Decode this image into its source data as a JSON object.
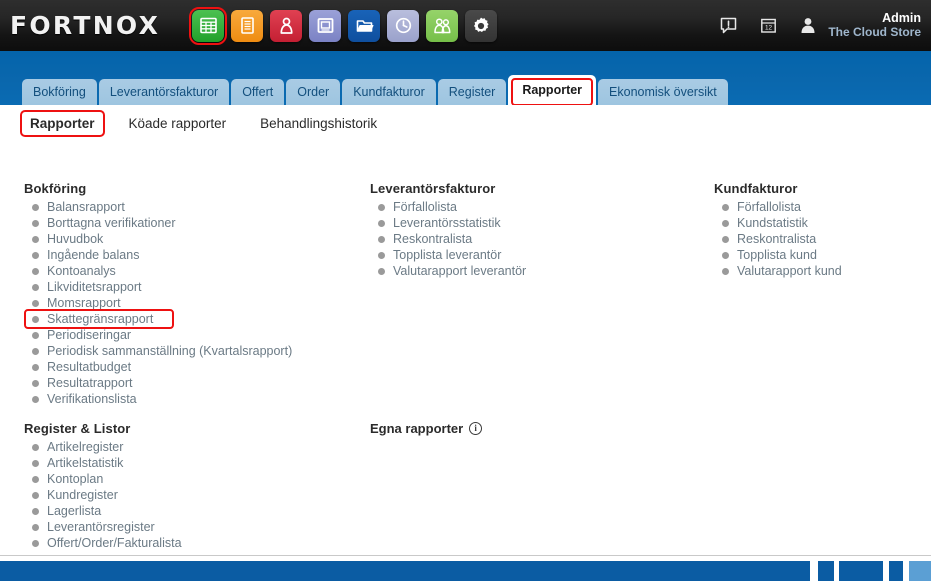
{
  "header": {
    "brand": "FORTNOX",
    "app_icons": [
      {
        "name": "spreadsheet-icon",
        "color": "#2ea732",
        "selected": true
      },
      {
        "name": "document-icon",
        "color": "#ef8c12",
        "selected": false
      },
      {
        "name": "person-icon",
        "color": "#c41f33",
        "selected": false
      },
      {
        "name": "window-icon",
        "color": "#7b82c4",
        "selected": false
      },
      {
        "name": "folder-icon",
        "color": "#0f4f9e",
        "selected": false
      },
      {
        "name": "clock-icon",
        "color": "#9aa1cb",
        "selected": false
      },
      {
        "name": "people-icon",
        "color": "#76bf49",
        "selected": false
      },
      {
        "name": "gear-icon",
        "color": "#333333",
        "selected": false
      }
    ],
    "notification_icon": "alert-icon",
    "calendar_icon": "calendar-icon",
    "calendar_day": "12",
    "avatar_icon": "user-avatar-icon",
    "user_name": "Admin",
    "user_org": "The Cloud Store",
    "accent_highlight": "#ee1111",
    "nav_band_color": "#0a67ad"
  },
  "tabs": [
    {
      "label": "Bokföring",
      "active": false
    },
    {
      "label": "Leverantörsfakturor",
      "active": false
    },
    {
      "label": "Offert",
      "active": false
    },
    {
      "label": "Order",
      "active": false
    },
    {
      "label": "Kundfakturor",
      "active": false
    },
    {
      "label": "Register",
      "active": false
    },
    {
      "label": "Rapporter",
      "active": true
    },
    {
      "label": "Ekonomisk översikt",
      "active": false
    }
  ],
  "subnav": [
    {
      "label": "Rapporter",
      "active": true
    },
    {
      "label": "Köade rapporter",
      "active": false
    },
    {
      "label": "Behandlingshistorik",
      "active": false
    }
  ],
  "groups": {
    "bokforing": {
      "title": "Bokföring",
      "items": [
        {
          "label": "Balansrapport",
          "highlighted": false
        },
        {
          "label": "Borttagna verifikationer",
          "highlighted": false
        },
        {
          "label": "Huvudbok",
          "highlighted": false
        },
        {
          "label": "Ingående balans",
          "highlighted": false
        },
        {
          "label": "Kontoanalys",
          "highlighted": false
        },
        {
          "label": "Likviditetsrapport",
          "highlighted": false
        },
        {
          "label": "Momsrapport",
          "highlighted": false
        },
        {
          "label": "Skattegränsrapport",
          "highlighted": true
        },
        {
          "label": "Periodiseringar",
          "highlighted": false
        },
        {
          "label": "Periodisk sammanställning (Kvartalsrapport)",
          "highlighted": false
        },
        {
          "label": "Resultatbudget",
          "highlighted": false
        },
        {
          "label": "Resultatrapport",
          "highlighted": false
        },
        {
          "label": "Verifikationslista",
          "highlighted": false
        }
      ]
    },
    "register_listor": {
      "title": "Register & Listor",
      "items": [
        {
          "label": "Artikelregister",
          "highlighted": false
        },
        {
          "label": "Artikelstatistik",
          "highlighted": false
        },
        {
          "label": "Kontoplan",
          "highlighted": false
        },
        {
          "label": "Kundregister",
          "highlighted": false
        },
        {
          "label": "Lagerlista",
          "highlighted": false
        },
        {
          "label": "Leverantörsregister",
          "highlighted": false
        },
        {
          "label": "Offert/Order/Fakturalista",
          "highlighted": false
        }
      ]
    },
    "leverantorsfakturor": {
      "title": "Leverantörsfakturor",
      "items": [
        {
          "label": "Förfallolista",
          "highlighted": false
        },
        {
          "label": "Leverantörsstatistik",
          "highlighted": false
        },
        {
          "label": "Reskontralista",
          "highlighted": false
        },
        {
          "label": "Topplista leverantör",
          "highlighted": false
        },
        {
          "label": "Valutarapport leverantör",
          "highlighted": false
        }
      ]
    },
    "kundfakturor": {
      "title": "Kundfakturor",
      "items": [
        {
          "label": "Förfallolista",
          "highlighted": false
        },
        {
          "label": "Kundstatistik",
          "highlighted": false
        },
        {
          "label": "Reskontralista",
          "highlighted": false
        },
        {
          "label": "Topplista kund",
          "highlighted": false
        },
        {
          "label": "Valutarapport kund",
          "highlighted": false
        }
      ]
    },
    "egna_rapporter": {
      "title": "Egna rapporter",
      "info_icon": "info-icon",
      "info_label": "i"
    }
  }
}
